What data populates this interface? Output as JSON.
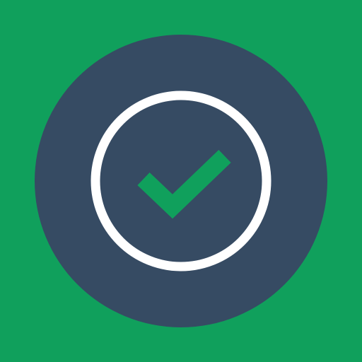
{
  "icon": {
    "name": "check-circle-icon",
    "colors": {
      "background": "#10A05C",
      "disc": "#364B63",
      "ring": "#FFFFFF",
      "check": "#10A05C"
    }
  }
}
